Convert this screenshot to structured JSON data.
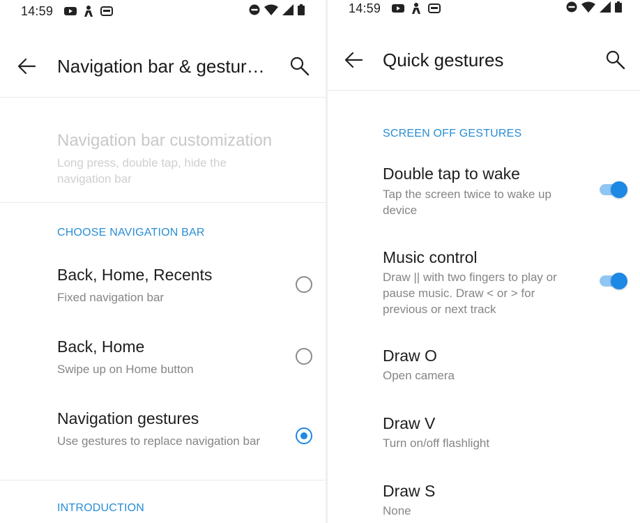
{
  "left": {
    "status": {
      "time": "14:59"
    },
    "title": "Navigation bar & gestur…",
    "customization": {
      "title": "Navigation bar customization",
      "subtitle": "Long press, double tap, hide the navigation bar"
    },
    "section_choose": "CHOOSE NAVIGATION BAR",
    "options": [
      {
        "title": "Back, Home, Recents",
        "subtitle": "Fixed navigation bar",
        "selected": false
      },
      {
        "title": "Back, Home",
        "subtitle": "Swipe up on Home button",
        "selected": false
      },
      {
        "title": "Navigation gestures",
        "subtitle": "Use gestures to replace navigation bar",
        "selected": true
      }
    ],
    "section_intro": "INTRODUCTION"
  },
  "right": {
    "status": {
      "time": "14:59"
    },
    "title": "Quick gestures",
    "section": "SCREEN OFF GESTURES",
    "items": [
      {
        "title": "Double tap to wake",
        "subtitle": "Tap the screen twice to wake up device",
        "toggle": true
      },
      {
        "title": "Music control",
        "subtitle": "Draw || with two fingers to play or pause music. Draw < or > for previous or next track",
        "toggle": true
      },
      {
        "title": "Draw O",
        "subtitle": "Open camera"
      },
      {
        "title": "Draw V",
        "subtitle": "Turn on/off flashlight"
      },
      {
        "title": "Draw S",
        "subtitle": "None"
      }
    ]
  },
  "colors": {
    "accent": "#1e88e5",
    "section_header": "#2a8dd4",
    "status_icons": "#222222"
  },
  "icons": [
    "back-arrow-icon",
    "search-icon",
    "radio-icon",
    "toggle-switch",
    "dnd-icon",
    "wifi-icon",
    "signal-icon",
    "battery-icon",
    "youtube-icon",
    "person-icon",
    "card-icon"
  ]
}
